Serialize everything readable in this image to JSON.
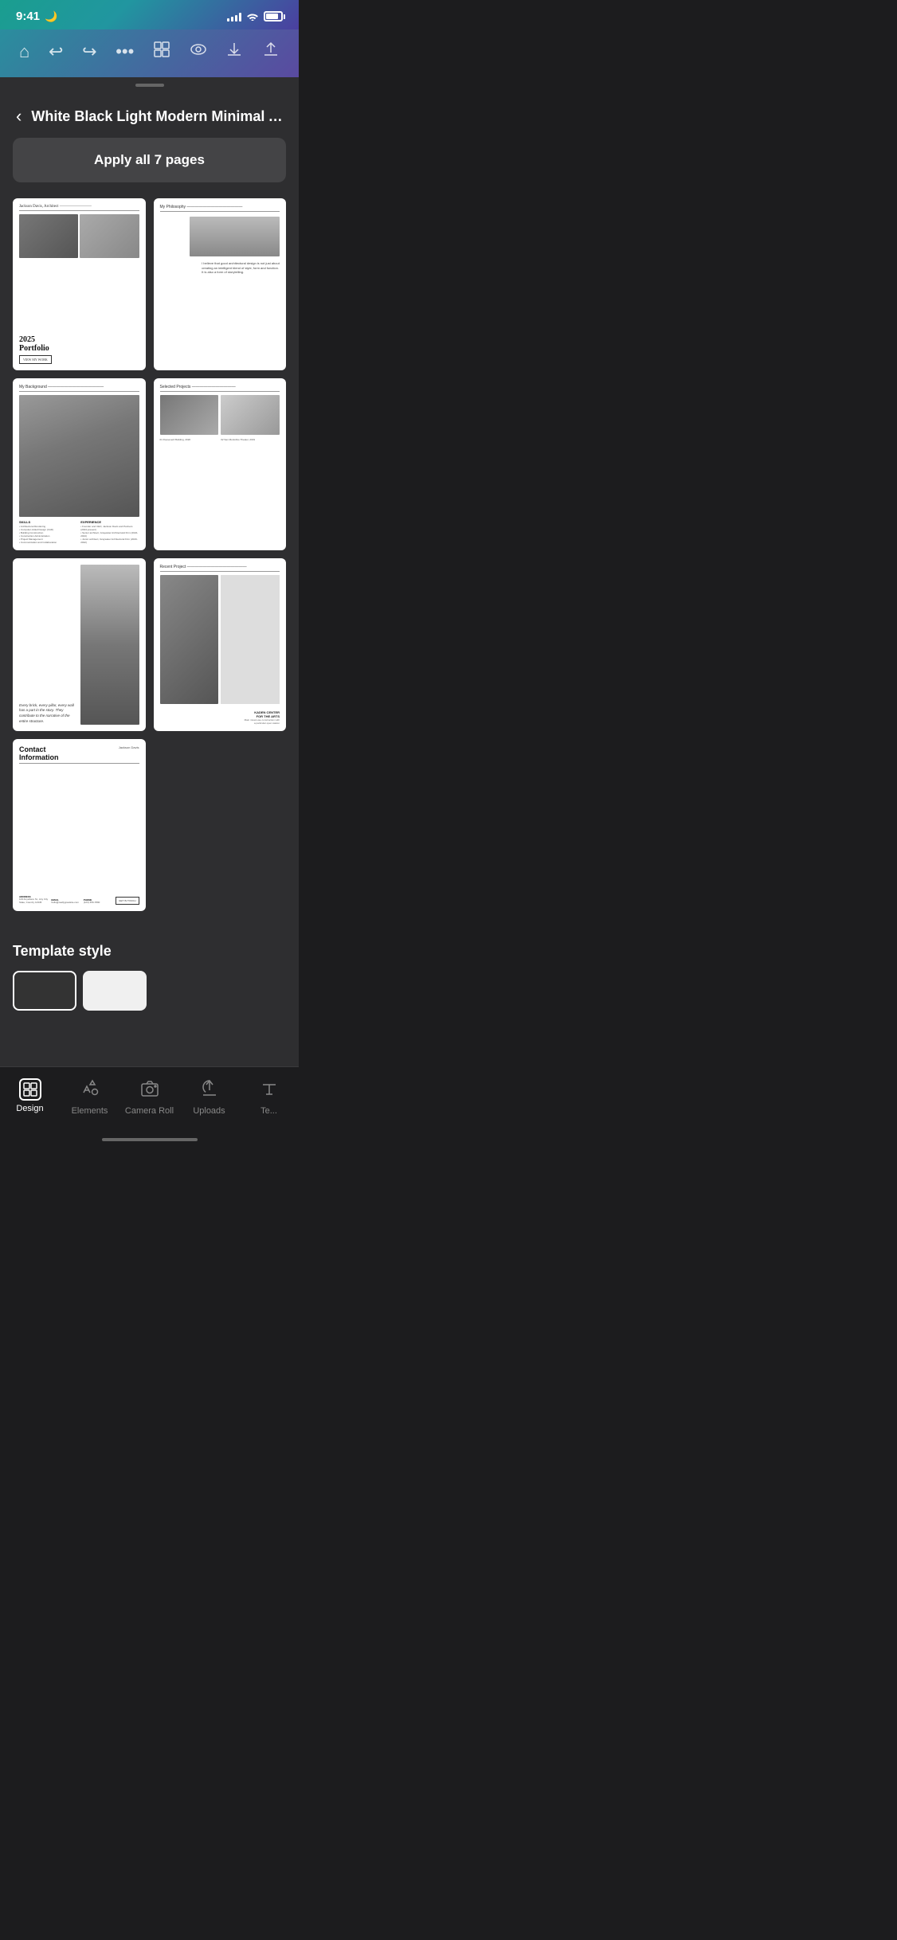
{
  "status_bar": {
    "time": "9:41",
    "moon_icon": "🌙"
  },
  "toolbar": {
    "icons": [
      "home",
      "undo",
      "redo",
      "more",
      "layers",
      "preview",
      "download",
      "share"
    ]
  },
  "sheet": {
    "back_label": "‹",
    "title": "White Black Light Modern Minimal Ar...",
    "apply_button_label": "Apply all 7 pages",
    "page_count": 7
  },
  "pages": [
    {
      "id": 1,
      "header": "Jackson Davis, Architect",
      "title_line1": "2025",
      "title_line2": "Portfolio",
      "btn_label": "VIEW MY WORK"
    },
    {
      "id": 2,
      "header": "My Philosophy",
      "body_text": "I believe that good architectural design is not just about creating an intelligent blend of style, form and function. It is also a form of storytelling."
    },
    {
      "id": 3,
      "header": "My Background",
      "skills_title": "SKILLS",
      "skills_items": [
        "Architectural Rendering",
        "Computer-Aided Design (CAD)",
        "Building Construction",
        "Construction Administration",
        "Project Management",
        "Communication and Collaboration"
      ],
      "exp_title": "EXPERIENCE",
      "exp_items": [
        "Founder and CEO, Jackson Davis and Partners (2024-present)",
        "Senior architect, Graywater Architectural Firm (2022-2024)",
        "Junior architect, Graywater Architectural Firm (2020-2022)"
      ]
    },
    {
      "id": 4,
      "header": "Selected Projects",
      "caption1": "01   Rooseverd Building, 2020",
      "caption2": "02   San Montshire Theater, 2019"
    },
    {
      "id": 5,
      "quote": "Every brick, every pillar, every wall has a part in the story. They contribute to the narrative of the entire structure."
    },
    {
      "id": 6,
      "header": "Recent Project",
      "project_name": "KADEN CENTER FOR THE ARTS",
      "project_sub": "Main mixed-use construction with a particular open station"
    },
    {
      "id": 7,
      "title_line1": "Contact",
      "title_line2": "Information",
      "name": "Jackson Davis",
      "address_label": "ADDRESS",
      "address": "123 Anywhere St., Any City State, Country 12345",
      "email_label": "EMAIL",
      "email": "hello@reallygreatsite.com",
      "phone_label": "PHONE",
      "phone": "(123) 456-7890",
      "cta_label": "GET IN TOUCH"
    }
  ],
  "template_style": {
    "label": "Template style",
    "options": [
      "dark",
      "light"
    ]
  },
  "bottom_nav": {
    "items": [
      {
        "id": "design",
        "label": "Design",
        "active": true
      },
      {
        "id": "elements",
        "label": "Elements",
        "active": false
      },
      {
        "id": "camera-roll",
        "label": "Camera Roll",
        "active": false
      },
      {
        "id": "uploads",
        "label": "Uploads",
        "active": false
      },
      {
        "id": "text",
        "label": "Te...",
        "active": false
      }
    ]
  }
}
